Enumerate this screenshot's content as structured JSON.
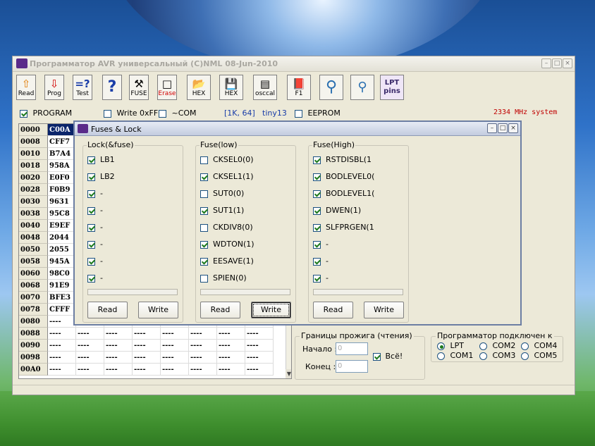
{
  "window": {
    "title": "Программатор AVR универсальный (C)NML 08-Jun-2010",
    "minimize": "–",
    "maximize": "□",
    "close": "×"
  },
  "toolbar": {
    "read": {
      "label": "Read",
      "icon": "⇧"
    },
    "prog": {
      "label": "Prog",
      "icon": "⇩"
    },
    "test": {
      "label": "Test",
      "icon": "=?"
    },
    "help": {
      "icon": "?"
    },
    "fuse": {
      "label": "FUSE",
      "icon": "⚒"
    },
    "erase": {
      "label": "Erase",
      "icon": "□"
    },
    "hex_open": {
      "label": "HEX",
      "icon": "📂"
    },
    "hex_save": {
      "label": "HEX",
      "icon": "💾"
    },
    "osccal": {
      "label": "osccal",
      "icon": "▤"
    },
    "f1": {
      "label": "F1",
      "icon": "📕"
    },
    "probe1": {
      "icon": "⚲"
    },
    "probe2": {
      "icon": "⚲"
    },
    "lpt": {
      "label1": "LPT",
      "label2": "pins"
    }
  },
  "options": {
    "program": {
      "label": "PROGRAM",
      "checked": true
    },
    "write_0xff": {
      "label": "Write 0xFF",
      "checked": false
    },
    "com": {
      "label": "~COM",
      "checked": false
    },
    "size": "[1K, 64]",
    "chip": "tiny13",
    "eeprom": {
      "label": "EEPROM",
      "checked": false
    },
    "clock": "2334 MHz system"
  },
  "memory": {
    "rows": [
      {
        "addr": "0000",
        "cells": [
          "C00A",
          "",
          "",
          "",
          "",
          "",
          "",
          ""
        ]
      },
      {
        "addr": "0008",
        "cells": [
          "CFF7",
          "",
          "",
          "",
          "",
          "",
          "",
          ""
        ]
      },
      {
        "addr": "0010",
        "cells": [
          "B7A4",
          "",
          "",
          "",
          "",
          "",
          "",
          ""
        ]
      },
      {
        "addr": "0018",
        "cells": [
          "958A",
          "",
          "",
          "",
          "",
          "",
          "",
          ""
        ]
      },
      {
        "addr": "0020",
        "cells": [
          "E0F0",
          "",
          "",
          "",
          "",
          "",
          "",
          ""
        ]
      },
      {
        "addr": "0028",
        "cells": [
          "F0B9",
          "",
          "",
          "",
          "",
          "",
          "",
          ""
        ]
      },
      {
        "addr": "0030",
        "cells": [
          "9631",
          "",
          "",
          "",
          "",
          "",
          "",
          ""
        ]
      },
      {
        "addr": "0038",
        "cells": [
          "95C8",
          "",
          "",
          "",
          "",
          "",
          "",
          ""
        ]
      },
      {
        "addr": "0040",
        "cells": [
          "E9EF",
          "",
          "",
          "",
          "",
          "",
          "",
          ""
        ]
      },
      {
        "addr": "0048",
        "cells": [
          "2044",
          "",
          "",
          "",
          "",
          "",
          "",
          ""
        ]
      },
      {
        "addr": "0050",
        "cells": [
          "2055",
          "",
          "",
          "",
          "",
          "",
          "",
          ""
        ]
      },
      {
        "addr": "0058",
        "cells": [
          "945A",
          "",
          "",
          "",
          "",
          "",
          "",
          ""
        ]
      },
      {
        "addr": "0060",
        "cells": [
          "98C0",
          "",
          "",
          "",
          "",
          "",
          "",
          ""
        ]
      },
      {
        "addr": "0068",
        "cells": [
          "91E9",
          "",
          "",
          "",
          "",
          "",
          "",
          ""
        ]
      },
      {
        "addr": "0070",
        "cells": [
          "BFE3",
          "",
          "",
          "",
          "",
          "",
          "",
          ""
        ]
      },
      {
        "addr": "0078",
        "cells": [
          "CFFF",
          "",
          "",
          "",
          "",
          "",
          "",
          ""
        ]
      },
      {
        "addr": "0080",
        "cells": [
          "----",
          "",
          "",
          "",
          "",
          "",
          "",
          ""
        ]
      },
      {
        "addr": "0088",
        "cells": [
          "----",
          "----",
          "----",
          "----",
          "----",
          "----",
          "----",
          "----"
        ]
      },
      {
        "addr": "0090",
        "cells": [
          "----",
          "----",
          "----",
          "----",
          "----",
          "----",
          "----",
          "----"
        ]
      },
      {
        "addr": "0098",
        "cells": [
          "----",
          "----",
          "----",
          "----",
          "----",
          "----",
          "----",
          "----"
        ]
      },
      {
        "addr": "00A0",
        "cells": [
          "----",
          "----",
          "----",
          "----",
          "----",
          "----",
          "----",
          "----"
        ]
      }
    ],
    "scroll_down": "▼"
  },
  "burn_range": {
    "title": "Границы прожига (чтения)",
    "start_label": "Начало :",
    "start_value": "0",
    "end_label": "Конец :",
    "end_value": "0",
    "all_label": "Всё!",
    "all_checked": true
  },
  "port": {
    "title": "Программатор подключен к",
    "options": [
      {
        "label": "LPT",
        "selected": true
      },
      {
        "label": "COM2",
        "selected": false
      },
      {
        "label": "COM4",
        "selected": false
      },
      {
        "label": "COM1",
        "selected": false
      },
      {
        "label": "COM3",
        "selected": false
      },
      {
        "label": "COM5",
        "selected": false
      }
    ]
  },
  "dialog": {
    "title": "Fuses & Lock",
    "minimize": "–",
    "maximize": "□",
    "close": "×",
    "groups": [
      {
        "title": "Lock(&fuse)",
        "bits": [
          {
            "label": "LB1",
            "checked": true
          },
          {
            "label": "LB2",
            "checked": true
          },
          {
            "label": "-",
            "checked": true
          },
          {
            "label": "-",
            "checked": true
          },
          {
            "label": "-",
            "checked": true
          },
          {
            "label": "-",
            "checked": true
          },
          {
            "label": "-",
            "checked": true
          },
          {
            "label": "-",
            "checked": true
          }
        ],
        "read": "Read",
        "write": "Write"
      },
      {
        "title": "Fuse(low)",
        "bits": [
          {
            "label": "CKSEL0(0)",
            "checked": false
          },
          {
            "label": "CKSEL1(1)",
            "checked": true
          },
          {
            "label": "SUT0(0)",
            "checked": false
          },
          {
            "label": "SUT1(1)",
            "checked": true
          },
          {
            "label": "CKDIV8(0)",
            "checked": false
          },
          {
            "label": "WDTON(1)",
            "checked": true
          },
          {
            "label": "EESAVE(1)",
            "checked": true
          },
          {
            "label": "SPIEN(0)",
            "checked": false
          }
        ],
        "read": "Read",
        "write": "Write"
      },
      {
        "title": "Fuse(High)",
        "bits": [
          {
            "label": "RSTDISBL(1",
            "checked": true
          },
          {
            "label": "BODLEVEL0(",
            "checked": true
          },
          {
            "label": "BODLEVEL1(",
            "checked": true
          },
          {
            "label": "DWEN(1)",
            "checked": true
          },
          {
            "label": "SLFPRGEN(1",
            "checked": true
          },
          {
            "label": "-",
            "checked": true
          },
          {
            "label": "-",
            "checked": true
          },
          {
            "label": "-",
            "checked": true
          }
        ],
        "read": "Read",
        "write": "Write"
      }
    ]
  },
  "colors": {
    "accent_blue": "#1a3da8",
    "clock_red": "#c00000",
    "selection": "#0a246a",
    "erase_red": "#d00000"
  }
}
